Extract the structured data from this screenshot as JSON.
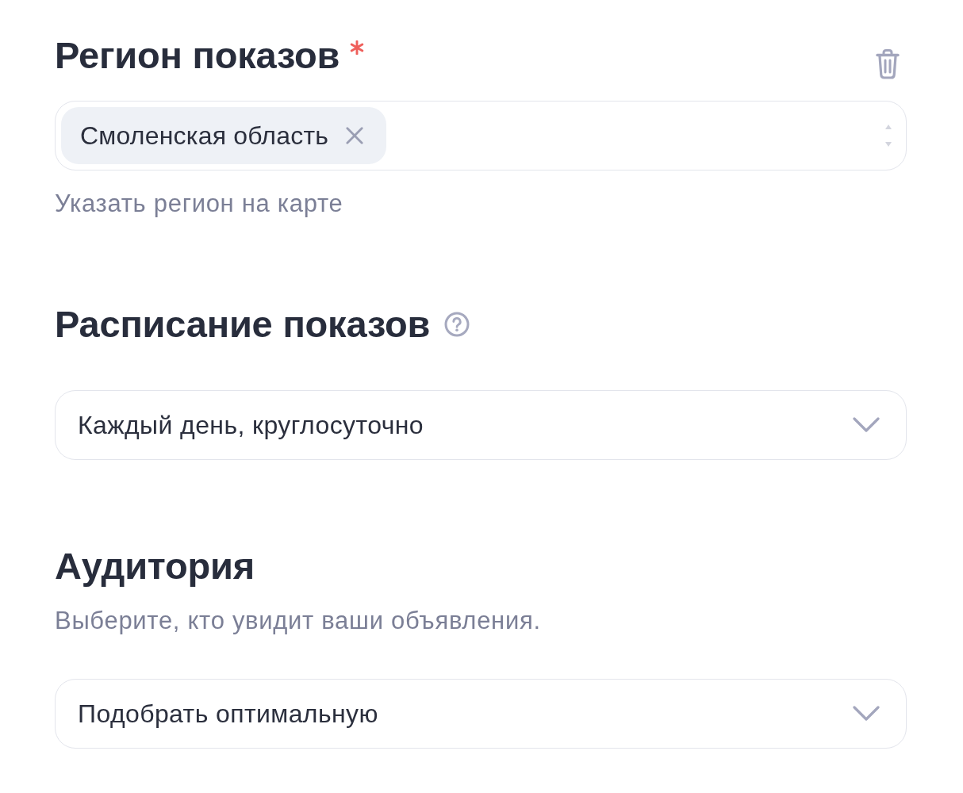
{
  "sections": [
    {
      "title": "Регион показов",
      "required": true,
      "deletable": true,
      "field": {
        "kind": "chips",
        "chips": [
          {
            "label": "Смоленская область"
          }
        ]
      },
      "link": "Указать регион на карте"
    },
    {
      "title": "Расписание показов",
      "help": true,
      "field": {
        "kind": "select",
        "value": "Каждый день, круглосуточно"
      }
    },
    {
      "title": "Аудитория",
      "description": "Выберите, кто увидит ваши объявления.",
      "field": {
        "kind": "select",
        "value": "Подобрать оптимальную"
      }
    }
  ]
}
